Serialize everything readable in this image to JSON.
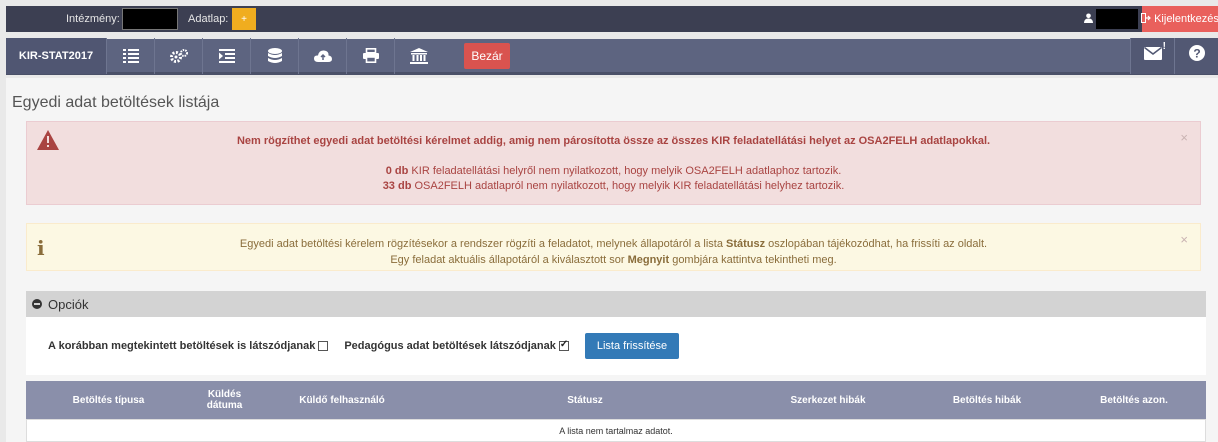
{
  "topbar": {
    "institution_label": "Intézmény:",
    "datasheet_label": "Adatlap:",
    "datasheet_btn": "+",
    "user_icon": "user-icon",
    "logout_label": "Kijelentkezés"
  },
  "navbar": {
    "brand": "KIR-STAT2017",
    "icons": [
      "list-icon",
      "gears-icon",
      "indent-icon",
      "database-icon",
      "cloud-upload-icon",
      "print-icon",
      "institution-icon"
    ],
    "close_label": "Bezár",
    "mail_badge": "!",
    "mail_icon": "envelope-icon",
    "help_icon": "question-icon"
  },
  "page": {
    "title": "Egyedi adat betöltések listája"
  },
  "alert_danger": {
    "icon": "warning-triangle-icon",
    "main": "Nem rögzíthet egyedi adat betöltési kérelmet addig, amig nem párosította össze az összes KIR feladatellátási helyet az OSA2FELH adatlapokkal.",
    "line1_count": "0 db",
    "line1_text": " KIR feladatellátási helyről nem nyilatkozott, hogy melyik OSA2FELH adatlaphoz tartozik.",
    "line2_count": "33 db",
    "line2_text": " OSA2FELH adatlapról nem nyilatkozott, hogy melyik KIR feladatellátási helyhez tartozik.",
    "close": "×"
  },
  "alert_warning": {
    "icon": "info-icon",
    "line1_pre": "Egyedi adat betöltési kérelem rögzítésekor a rendszer rögzíti a feladatot, melynek állapotáról a lista ",
    "line1_bold": "Státusz",
    "line1_post": " oszlopában tájékozódhat, ha frissíti az oldalt.",
    "line2_pre": "Egy feladat aktuális állapotáról a kiválasztott sor ",
    "line2_bold": "Megnyit",
    "line2_post": " gombjára kattintva tekintheti meg.",
    "close": "×"
  },
  "options": {
    "header": "Opciók",
    "opt1_label": "A korábban megtekintett betöltések is látszódjanak",
    "opt1_checked": false,
    "opt2_label": "Pedagógus adat betöltések látszódjanak",
    "opt2_checked": true,
    "refresh_label": "Lista frissítése"
  },
  "table": {
    "columns": [
      "Betöltés típusa",
      "Küldés dátuma",
      "Küldő felhasználó",
      "Státusz",
      "Szerkezet hibák",
      "Betöltés hibák",
      "Betöltés azon."
    ],
    "empty_text": "A lista nem tartalmaz adatot."
  },
  "colors": {
    "topbar": "#3c3f52",
    "navbar": "#5d6480",
    "logout": "#e9605c",
    "close_button": "#d9534f",
    "refresh_button": "#337ab7",
    "table_header": "#8a8faa"
  }
}
